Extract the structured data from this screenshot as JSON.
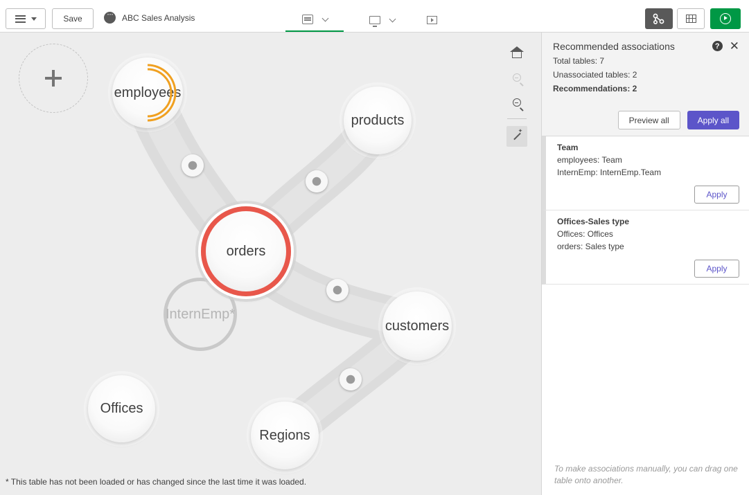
{
  "toolbar": {
    "save_label": "Save",
    "app_title": "ABC Sales Analysis",
    "active_tab": "data-manager"
  },
  "nodes": {
    "add": "",
    "employees": "employees",
    "products": "products",
    "orders": "orders",
    "internemp": "InternEmp*",
    "customers": "customers",
    "offices": "Offices",
    "regions": "Regions"
  },
  "footnote": "* This table has not been loaded or has changed since the last time it was loaded.",
  "panel": {
    "title": "Recommended associations",
    "total_tables": "Total tables: 7",
    "unassociated_tables": "Unassociated tables: 2",
    "recommendations": "Recommendations: 2",
    "preview_all": "Preview all",
    "apply_all": "Apply all",
    "recommendation_items": [
      {
        "name": "Team",
        "lines": [
          "employees: Team",
          "InternEmp: InternEmp.Team"
        ],
        "apply": "Apply"
      },
      {
        "name": "Offices-Sales type",
        "lines": [
          "Offices: Offices",
          "orders: Sales type"
        ],
        "apply": "Apply"
      }
    ],
    "hint": "To make associations manually, you can drag one table onto another."
  },
  "colors": {
    "accent_green": "#009845",
    "orders_ring": "#e8574b",
    "employees_arc": "#f0a020",
    "primary_button": "#5c55c9",
    "canvas_bg": "#ededed"
  },
  "icons": [
    "menu-icon",
    "app-icon",
    "data-manager-icon",
    "sheet-icon",
    "present-icon",
    "model-viewer-icon",
    "table-view-icon",
    "run-icon",
    "home-icon",
    "zoom-in-icon",
    "zoom-out-icon",
    "magic-wand-icon",
    "help-icon",
    "close-icon"
  ]
}
